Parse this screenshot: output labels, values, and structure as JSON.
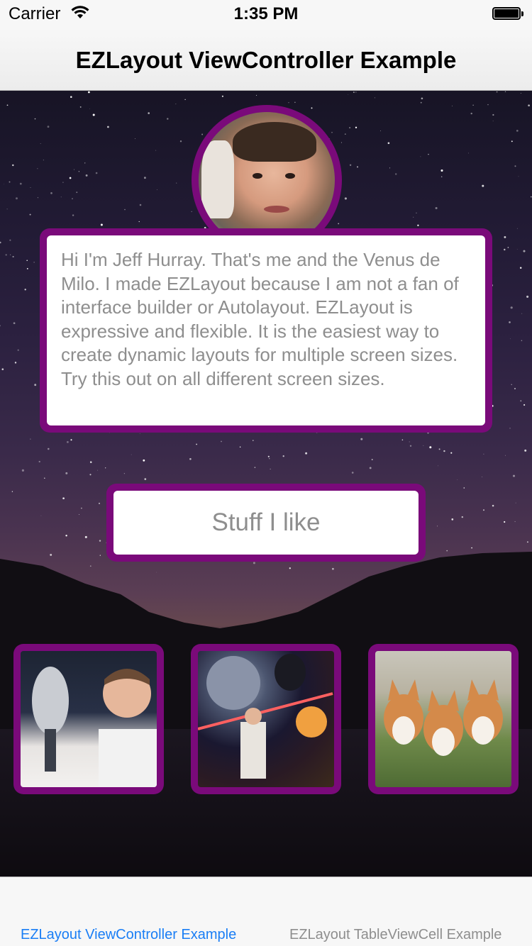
{
  "status_bar": {
    "carrier": "Carrier",
    "time": "1:35 PM",
    "wifi_icon": "wifi-icon",
    "battery_icon": "battery-icon"
  },
  "nav_bar": {
    "title": "EZLayout ViewController Example"
  },
  "profile": {
    "avatar_icon": "avatar-photo",
    "bio": "Hi I'm Jeff Hurray. That's me and the Venus de Milo. I made EZLayout because I am not a fan of interface builder or Autolayout. EZLayout is expressive and flexible. It is the easiest way to create dynamic layouts for multiple screen sizes. Try this out on all different screen sizes."
  },
  "stuff_button": {
    "label": "Stuff I like"
  },
  "thumbnails": [
    {
      "name": "trophy-photo"
    },
    {
      "name": "star-wars-poster"
    },
    {
      "name": "corgi-puppies-photo"
    }
  ],
  "tab_bar": {
    "tabs": [
      {
        "label": "EZLayout ViewController Example",
        "active": true
      },
      {
        "label": "EZLayout TableViewCell Example",
        "active": false
      }
    ]
  },
  "colors": {
    "accent_border": "#7a0a7a",
    "active_tab": "#1a7ef5",
    "inactive_text": "#8e8e8e"
  }
}
